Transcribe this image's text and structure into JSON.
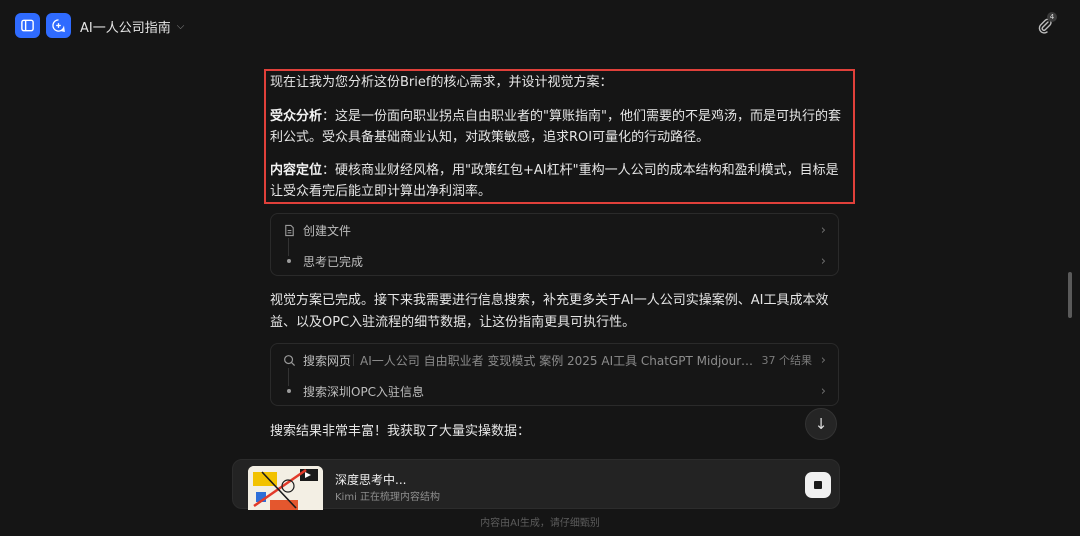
{
  "header": {
    "title": "AI一人公司指南",
    "attachment_count": "4"
  },
  "message": {
    "intro": "现在让我为您分析这份Brief的核心需求，并设计视觉方案：",
    "audience_label": "受众分析",
    "audience_text": "：这是一份面向职业拐点自由职业者的\"算账指南\"，他们需要的不是鸡汤，而是可执行的套利公式。受众具备基础商业认知，对政策敏感，追求ROI可量化的行动路径。",
    "position_label": "内容定位",
    "position_text": "：硬核商业财经风格，用\"政策红包+AI杠杆\"重构一人公司的成本结构和盈利模式，目标是让受众看完后能立即计算出净利润率。"
  },
  "step_card_1": {
    "create_file": "创建文件",
    "thinking_done": "思考已完成"
  },
  "message2": {
    "text": "视觉方案已完成。接下来我需要进行信息搜索，补充更多关于AI一人公司实操案例、AI工具成本效益、以及OPC入驻流程的细节数据，让这份指南更具可执行性。"
  },
  "step_card_2": {
    "search_label": "搜索网页",
    "search_query": "AI一人公司 自由职业者 变现模式 案例 2025 AI工具 ChatGPT Midjourney Copilot 成本",
    "result_count": "37 个结果",
    "search_sub": "搜索深圳OPC入驻信息"
  },
  "message3": {
    "text": "搜索结果非常丰富！我获取了大量实操数据："
  },
  "status": {
    "title": "深度思考中...",
    "subtitle": "Kimi 正在梳理内容结构"
  },
  "footer": {
    "text": "内容由AI生成，请仔细甄别"
  },
  "colors": {
    "accent": "#2f6bff",
    "highlight_border": "#e0403a",
    "background": "#151515"
  }
}
